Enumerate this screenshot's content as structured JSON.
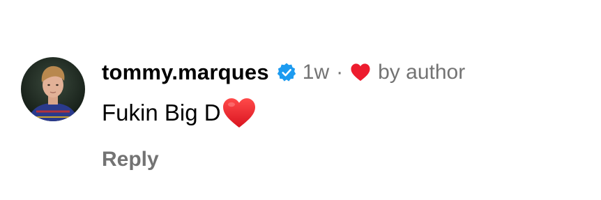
{
  "comment": {
    "username": "tommy.marques",
    "time": "1w",
    "separator": "·",
    "liked_by": "by author",
    "text": "Fukin Big D",
    "reply_label": "Reply",
    "icons": {
      "avatar": "profile-photo",
      "verified": "verified-badge-icon",
      "author_like": "heart-icon",
      "emoji": "red-heart-emoji"
    }
  },
  "colors": {
    "text_primary": "#000000",
    "text_secondary": "#737373",
    "verified_blue": "#1d9bf0",
    "heart_red": "#ed1c2e"
  }
}
